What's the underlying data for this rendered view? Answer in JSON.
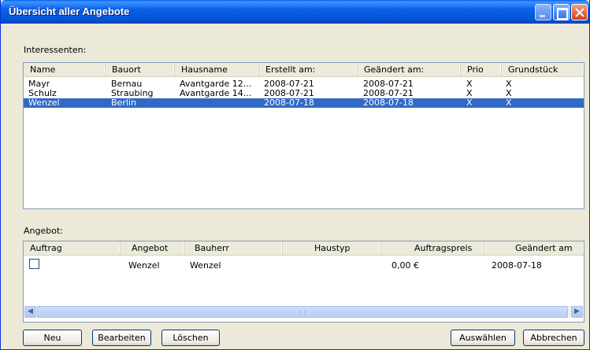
{
  "window": {
    "title": "Übersicht aller Angebote"
  },
  "interessenten": {
    "label": "Interessenten:",
    "columns": [
      "Name",
      "Bauort",
      "Hausname",
      "Erstellt am:",
      "Geändert am:",
      "Prio",
      "Grundstück"
    ],
    "rows": [
      {
        "name": "Mayr",
        "bauort": "Bernau",
        "hausname": "Avantgarde 12...",
        "erstellt": "2008-07-21",
        "geaendert": "2008-07-21",
        "prio": "X",
        "grundstueck": "X",
        "selected": false
      },
      {
        "name": "Schulz",
        "bauort": "Straubing",
        "hausname": "Avantgarde 14...",
        "erstellt": "2008-07-21",
        "geaendert": "2008-07-21",
        "prio": "X",
        "grundstueck": "X",
        "selected": false
      },
      {
        "name": "Wenzel",
        "bauort": "Berlin",
        "hausname": "",
        "erstellt": "2008-07-18",
        "geaendert": "2008-07-18",
        "prio": "X",
        "grundstueck": "X",
        "selected": true
      }
    ]
  },
  "angebot": {
    "label": "Angebot:",
    "columns": [
      "Auftrag",
      "Angebot",
      "Bauherr",
      "Haustyp",
      "Auftragspreis",
      "Geändert am"
    ],
    "rows": [
      {
        "auftrag": false,
        "angebot": "Wenzel",
        "bauherr": "Wenzel",
        "haustyp": "",
        "auftragspreis": "0,00 €",
        "geaendert": "2008-07-18"
      }
    ]
  },
  "buttons": {
    "neu": "Neu",
    "bearbeiten": "Bearbeiten",
    "loeschen": "Löschen",
    "auswaehlen": "Auswählen",
    "abbrechen": "Abbrechen"
  },
  "icons": {
    "minimize": "minimize-icon",
    "maximize": "maximize-icon",
    "close": "close-icon",
    "scroll_left": "arrow-left-icon",
    "scroll_right": "arrow-right-icon"
  },
  "colors": {
    "selection": "#316ac5",
    "titlebar": "#0a5fe8",
    "dialog_bg": "#ece9d8"
  }
}
